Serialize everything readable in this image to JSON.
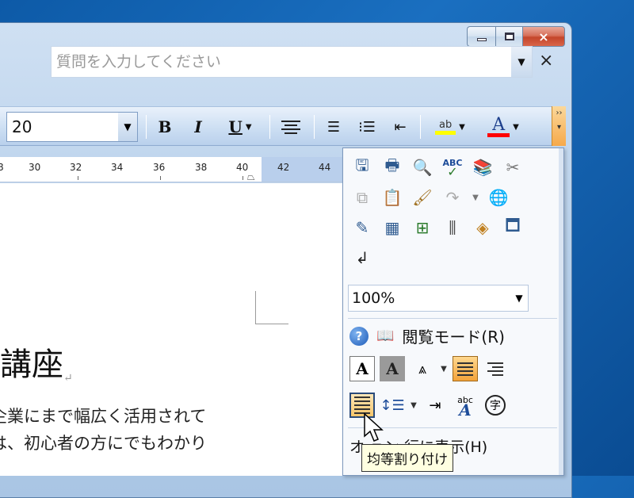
{
  "help": {
    "placeholder": "質問を入力してください",
    "close_glyph": "×"
  },
  "titlebar": {
    "close_glyph": "×"
  },
  "toolbar": {
    "font_size": "20",
    "bold_label": "B",
    "italic_label": "I",
    "underline_label": "U",
    "highlight_label": "ab",
    "highlight_color": "#ffff00",
    "font_color_label": "A",
    "font_color": "#ff0000",
    "overflow_glyph": "››"
  },
  "ruler": {
    "ticks": [
      "30",
      "32",
      "34",
      "36",
      "38",
      "40",
      "42",
      "44"
    ]
  },
  "document": {
    "heading": "講座",
    "return_mark": "↵",
    "line1": "企業にまで幅広く活用されて",
    "line2": "は、初心者の方にでもわかり"
  },
  "panel": {
    "zoom": "100%",
    "read_mode_label": "閲覧モード(R)",
    "circle_char": "字",
    "abc_label": "abc",
    "show_item_label": "オ    ョン   行に表示(H)"
  },
  "tooltip": {
    "text": "均等割り付け"
  },
  "colors": {
    "accent_orange": "#f3a33a",
    "toolbar_blue": "#cddff3"
  }
}
